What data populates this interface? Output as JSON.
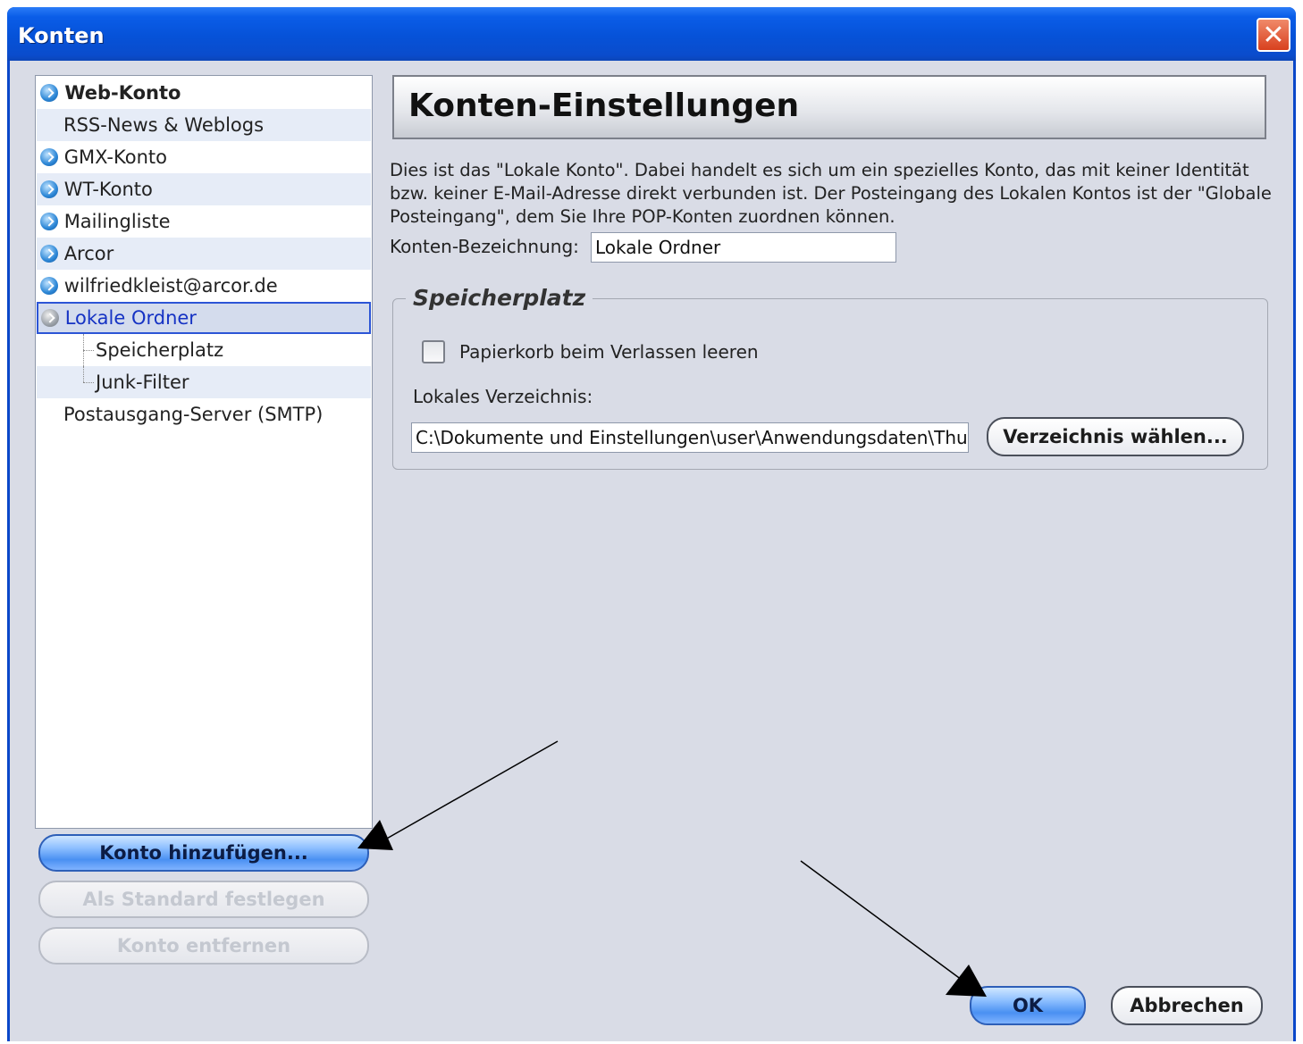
{
  "window": {
    "title": "Konten",
    "close_glyph": "✕"
  },
  "tree": {
    "items": [
      {
        "label": "Web-Konto",
        "icon": "account-icon"
      },
      {
        "label": "RSS-News & Weblogs",
        "icon": ""
      },
      {
        "label": "GMX-Konto",
        "icon": "account-icon"
      },
      {
        "label": "WT-Konto",
        "icon": "account-icon"
      },
      {
        "label": "Mailingliste",
        "icon": "account-icon"
      },
      {
        "label": "Arcor",
        "icon": "account-icon"
      },
      {
        "label": "wilfriedkleist@arcor.de",
        "icon": "account-icon"
      },
      {
        "label": "Lokale Ordner",
        "icon": "local-folder-icon",
        "selected": true
      },
      {
        "label": "Speicherplatz",
        "icon": ""
      },
      {
        "label": "Junk-Filter",
        "icon": ""
      },
      {
        "label": "Postausgang-Server (SMTP)",
        "icon": ""
      }
    ]
  },
  "left_buttons": {
    "add_account": "Konto hinzufügen...",
    "set_default": "Als Standard festlegen",
    "remove_account": "Konto entfernen"
  },
  "panel": {
    "header": "Konten-Einstellungen",
    "description": "Dies ist das \"Lokale Konto\". Dabei handelt es sich um ein spezielles Konto, das mit keiner Identität bzw. keiner E-Mail-Adresse direkt verbunden ist. Der Posteingang des Lokalen Kontos ist der \"Globale Posteingang\", dem Sie Ihre POP-Konten zuordnen können.",
    "account_name_label": "Konten-Bezeichnung:",
    "account_name_value": "Lokale Ordner",
    "storage_group_title": "Speicherplatz",
    "empty_trash_label": "Papierkorb beim Verlassen leeren",
    "empty_trash_checked": false,
    "local_dir_label": "Lokales Verzeichnis:",
    "local_dir_value": "C:\\Dokumente und Einstellungen\\user\\Anwendungsdaten\\Thund",
    "choose_dir_button": "Verzeichnis wählen..."
  },
  "footer": {
    "ok": "OK",
    "cancel": "Abbrechen"
  },
  "colors": {
    "titlebar": "#0a5de8",
    "client_bg": "#d9dce6",
    "selection_border": "#2c55d6",
    "arrow": "#000000"
  }
}
